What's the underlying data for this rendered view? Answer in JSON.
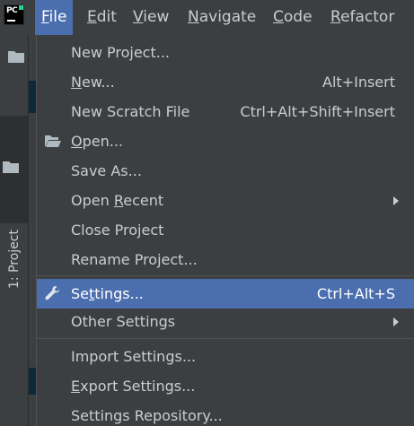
{
  "menubar": {
    "logo_text": "PC",
    "items": [
      {
        "label_mn": "F",
        "label_rest": "ile"
      },
      {
        "label_mn": "E",
        "label_rest": "dit"
      },
      {
        "label_mn": "V",
        "label_rest": "iew"
      },
      {
        "label_mn": "N",
        "label_rest": "avigate"
      },
      {
        "label_mn": "C",
        "label_rest": "ode"
      },
      {
        "label_mn": "R",
        "label_rest": "efactor"
      }
    ]
  },
  "toolstrip": {
    "project_tab": "1: Project"
  },
  "file_menu": {
    "items": [
      {
        "label_pre": "New Project...",
        "label_mn": "",
        "label_post": "",
        "shortcut": ""
      },
      {
        "label_pre": "",
        "label_mn": "N",
        "label_post": "ew...",
        "shortcut": "Alt+Insert"
      },
      {
        "label_pre": "New Scratch File",
        "label_mn": "",
        "label_post": "",
        "shortcut": "Ctrl+Alt+Shift+Insert"
      },
      {
        "label_pre": "",
        "label_mn": "O",
        "label_post": "pen...",
        "shortcut": "",
        "icon": "open-folder-icon"
      },
      {
        "label_pre": "Save As...",
        "label_mn": "",
        "label_post": "",
        "shortcut": ""
      },
      {
        "label_pre": "Open ",
        "label_mn": "R",
        "label_post": "ecent",
        "shortcut": "",
        "submenu": true
      },
      {
        "label_pre": "Close Project",
        "label_mn": "",
        "label_post": "",
        "shortcut": ""
      },
      {
        "label_pre": "Rename Project...",
        "label_mn": "",
        "label_post": "",
        "shortcut": ""
      },
      {
        "label_pre": "Se",
        "label_mn": "t",
        "label_post": "tings...",
        "shortcut": "Ctrl+Alt+S",
        "icon": "wrench-icon",
        "selected": true
      },
      {
        "label_pre": "Other Settings",
        "label_mn": "",
        "label_post": "",
        "shortcut": "",
        "submenu": true
      },
      {
        "label_pre": "Import Settings...",
        "label_mn": "",
        "label_post": "",
        "shortcut": ""
      },
      {
        "label_pre": "",
        "label_mn": "E",
        "label_post": "xport Settings...",
        "shortcut": ""
      },
      {
        "label_pre": "Settings Repository...",
        "label_mn": "",
        "label_post": "",
        "shortcut": ""
      }
    ]
  },
  "colors": {
    "background": "#3c3f41",
    "selection": "#4b6eaf",
    "text": "#cccccc",
    "separator": "#515151"
  }
}
